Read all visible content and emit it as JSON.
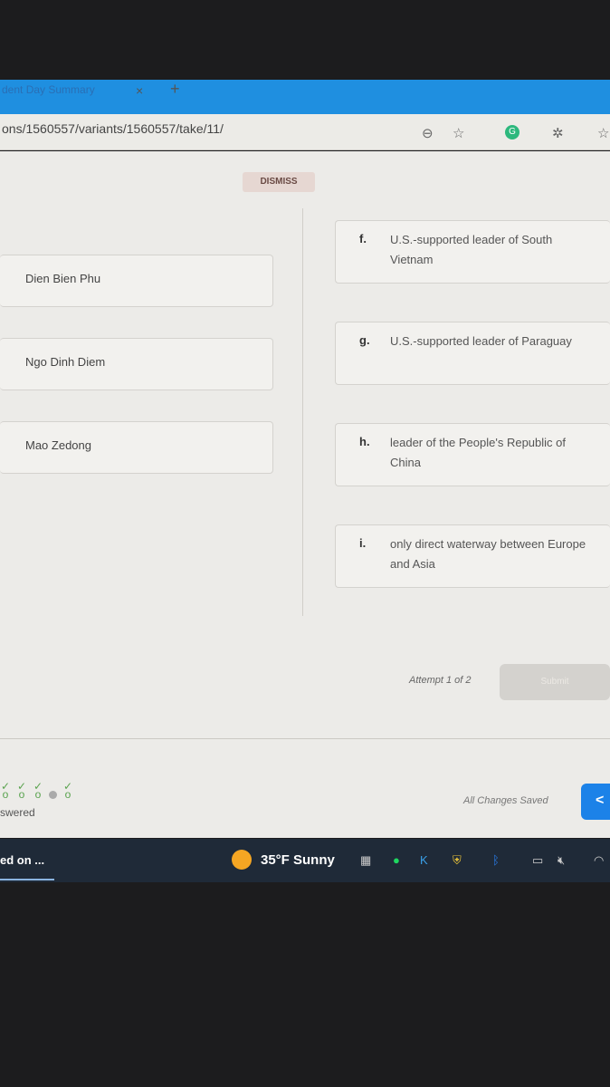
{
  "browser": {
    "tab_title": "dent Day Summary",
    "tab_close": "×",
    "new_tab": "+",
    "url": "ons/1560557/variants/1560557/take/11/",
    "icons": [
      "zoom-out-icon",
      "favorites-add-icon",
      "grammarly-icon",
      "extensions-icon",
      "favorites-icon"
    ]
  },
  "notice": {
    "dismiss_label": "DISMISS"
  },
  "left_items": [
    "Dien Bien Phu",
    "Ngo Dinh Diem",
    "Mao Zedong"
  ],
  "right_items": [
    {
      "letter": "f.",
      "text": "U.S.-supported leader of South Vietnam"
    },
    {
      "letter": "g.",
      "text": "U.S.-supported leader of Paraguay"
    },
    {
      "letter": "h.",
      "text": "leader of the People's Republic of China"
    },
    {
      "letter": "i.",
      "text": "only direct waterway between Europe and Asia"
    }
  ],
  "footer": {
    "attempt": "Attempt 1 of 2",
    "submit_label": "Submit",
    "answered": "swered",
    "saved": "All Changes Saved",
    "back": "<"
  },
  "taskbar": {
    "task": "ed on ...",
    "weather": "35°F  Sunny",
    "accent": "#1c82e8"
  }
}
